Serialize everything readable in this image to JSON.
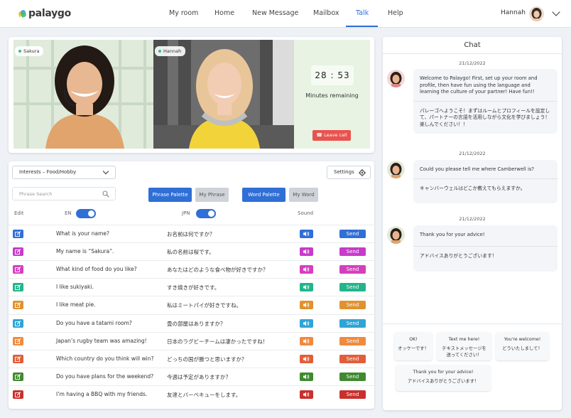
{
  "brand": {
    "name": "palaygo"
  },
  "nav": {
    "items": [
      "My room",
      "Home",
      "New Message",
      "Mailbox",
      "Talk",
      "Help"
    ],
    "active": "Talk"
  },
  "user": {
    "name": "Hannah"
  },
  "video": {
    "participants": [
      "Sakura",
      "Hannah"
    ],
    "timer_minutes": "28",
    "timer_seconds": "53",
    "timer_sep": ":",
    "remaining_label": "Minutes remaining",
    "leave_label": "Leave call"
  },
  "phrases": {
    "category": "Interests – Food/Hobby",
    "settings_label": "Settings",
    "search_placeholder": "Phrase Search",
    "tabs": {
      "phrase_palette": "Phrase Palette",
      "my_phrase": "My Phrase",
      "word_palette": "Word Palette",
      "my_word": "My Word"
    },
    "headers": {
      "edit": "Edit",
      "en": "EN",
      "jpn": "JPN",
      "sound": "Sound"
    },
    "send_label": "Send",
    "rows": [
      {
        "en": "What is your name?",
        "jp": "お名前は何ですか？",
        "color": "#2f6fd6"
      },
      {
        "en": "My name is “Sakura”.",
        "jp": "私の名前は桜です。",
        "color": "#c63bc9"
      },
      {
        "en": "What kind of food do you like?",
        "jp": "あなたはどのような食べ物が好きですか？",
        "color": "#d63ec0"
      },
      {
        "en": "I like sukiyaki.",
        "jp": "すき焼きが好きです。",
        "color": "#22b58a"
      },
      {
        "en": "I like meat pie.",
        "jp": "私はミートパイが好きですね。",
        "color": "#e0922e"
      },
      {
        "en": "Do you have a tatami room?",
        "jp": "畳の部屋はありますか？",
        "color": "#2fa4d6"
      },
      {
        "en": "Japan’s rugby team was amazing!",
        "jp": "日本のラグビーチームは凄かったですね！",
        "color": "#f08a3e"
      },
      {
        "en": "Which country do you think will win?",
        "jp": "どっちの国が勝つと思いますか？",
        "color": "#e05f3a"
      },
      {
        "en": "Do you have plans for the weekend?",
        "jp": "今週は予定がありますか？",
        "color": "#3f8a2f"
      },
      {
        "en": "I’m having a BBQ with my friends.",
        "jp": "友達とバーベキューをします。",
        "color": "#c9302c"
      }
    ]
  },
  "chat": {
    "title": "Chat",
    "messages": [
      {
        "date": "21/12/2022",
        "en": "Welcome to Palaygo! First, set up your room and profile, then have fun using the language and learning the culture of your partner! Have fun!!",
        "jp": "パレーゴへようこそ！まずはルームとプロフィールを設定して、パートナーの言語を活用しながら文化を学びましょう！楽しんでください！！"
      },
      {
        "date": "21/12/2022",
        "en": "Could you please tell me where Camberwell is?",
        "jp": "キャンバーウェルはどこか教えてもらえますか。"
      },
      {
        "date": "21/12/2022",
        "en": "Thank you for your advice!",
        "jp": "アドバイスありがとうございます！"
      }
    ],
    "quick_replies": [
      {
        "en": "OK!",
        "jp": "オッケーです！"
      },
      {
        "en": "Text me here!",
        "jp": "テキストメッセージを送ってください！"
      },
      {
        "en": "You're welcome!",
        "jp": "どういたしまして！"
      },
      {
        "en": "Thank you for your advice!",
        "jp": "アドバイスありがとうございます！"
      }
    ]
  },
  "colors": {
    "accent": "#2f6fd6",
    "leave": "#e8534f",
    "timer_panel": "#e8f3e3"
  }
}
